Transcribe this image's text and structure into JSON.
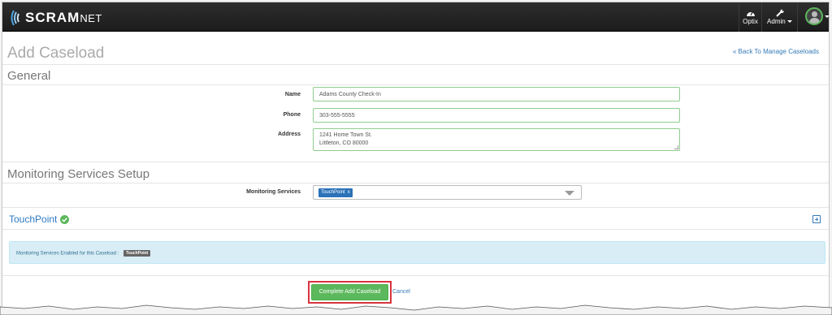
{
  "brand": {
    "name": "SCRAM",
    "suffix": "NET"
  },
  "navbar": {
    "optix_label": "Optix",
    "admin_label": "Admin",
    "accent_color": "#5cb85c"
  },
  "page": {
    "title": "Add Caseload",
    "back_link": "« Back To Manage Caseloads"
  },
  "general": {
    "heading": "General",
    "name": {
      "label": "Name",
      "value": "Adams County Check-In"
    },
    "phone": {
      "label": "Phone",
      "value": "303-555-5555"
    },
    "address": {
      "label": "Address",
      "line1": "1241 Home Town St.",
      "line2": "Littleton, CO 80000"
    }
  },
  "monitoring": {
    "heading": "Monitoring Services Setup",
    "label": "Monitoring Services",
    "selected": [
      {
        "label": "TouchPoint",
        "remove": "x"
      }
    ]
  },
  "touchpoint": {
    "title": "TouchPoint",
    "status_icon": "check-circle-icon",
    "expand_icon": "plus-square-icon"
  },
  "info": {
    "text": "Monitoring Services Enabled for this Caseload :",
    "badge": "TouchPoint"
  },
  "actions": {
    "complete": "Complete Add Caseload",
    "cancel": "Cancel",
    "highlight_color": "#d9333f"
  }
}
